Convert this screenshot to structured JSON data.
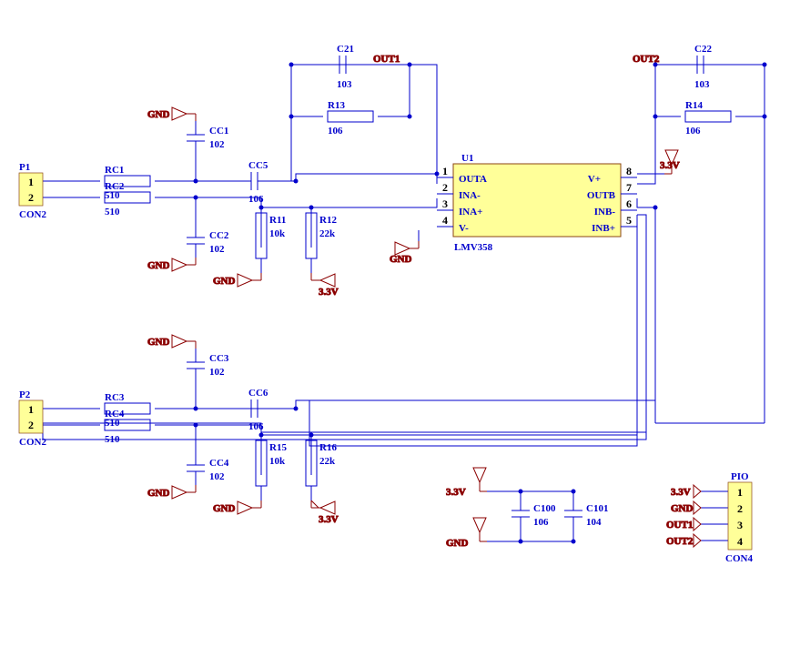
{
  "ic": {
    "ref": "U1",
    "part": "LMV358",
    "pins": [
      {
        "num": "1",
        "name": "OUTA"
      },
      {
        "num": "2",
        "name": "INA-"
      },
      {
        "num": "3",
        "name": "INA+"
      },
      {
        "num": "4",
        "name": "V-"
      },
      {
        "num": "8",
        "name": "V+"
      },
      {
        "num": "7",
        "name": "OUTB"
      },
      {
        "num": "6",
        "name": "INB-"
      },
      {
        "num": "5",
        "name": "INB+"
      }
    ]
  },
  "resistors": [
    {
      "ref": "RC1",
      "val": "510"
    },
    {
      "ref": "RC2",
      "val": "510"
    },
    {
      "ref": "RC3",
      "val": "510"
    },
    {
      "ref": "RC4",
      "val": "510"
    },
    {
      "ref": "R11",
      "val": "10k"
    },
    {
      "ref": "R12",
      "val": "22k"
    },
    {
      "ref": "R13",
      "val": "106"
    },
    {
      "ref": "R14",
      "val": "106"
    },
    {
      "ref": "R15",
      "val": "10k"
    },
    {
      "ref": "R16",
      "val": "22k"
    }
  ],
  "caps": [
    {
      "ref": "CC1",
      "val": "102"
    },
    {
      "ref": "CC2",
      "val": "102"
    },
    {
      "ref": "CC3",
      "val": "102"
    },
    {
      "ref": "CC4",
      "val": "102"
    },
    {
      "ref": "CC5",
      "val": "106"
    },
    {
      "ref": "CC6",
      "val": "106"
    },
    {
      "ref": "C21",
      "val": "103"
    },
    {
      "ref": "C22",
      "val": "103"
    },
    {
      "ref": "C100",
      "val": "106"
    },
    {
      "ref": "C101",
      "val": "104"
    }
  ],
  "conns": [
    {
      "ref": "P1",
      "part": "CON2",
      "pins": [
        "1",
        "2"
      ]
    },
    {
      "ref": "P2",
      "part": "CON2",
      "pins": [
        "1",
        "2"
      ]
    },
    {
      "ref": "PIO",
      "part": "CON4",
      "pins": [
        "1",
        "2",
        "3",
        "4"
      ]
    }
  ],
  "nets": {
    "gnd": "GND",
    "v33": "3.3V",
    "out1": "OUT1",
    "out2": "OUT2"
  }
}
